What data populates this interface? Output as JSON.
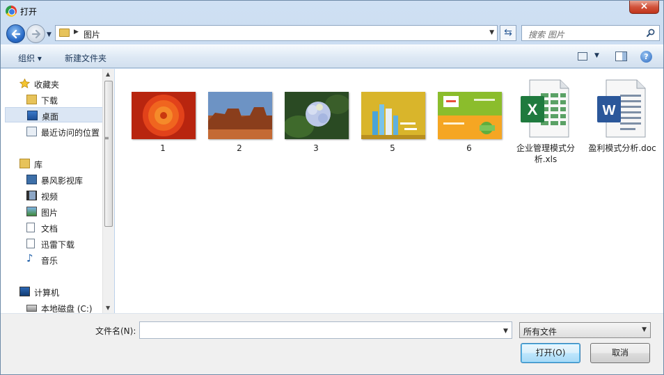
{
  "window": {
    "title": "打开",
    "close_label": "×"
  },
  "address": {
    "path": "图片",
    "search_placeholder": "搜索 图片"
  },
  "toolbar": {
    "organize_label": "组织 ▾",
    "new_folder_label": "新建文件夹"
  },
  "nav": {
    "favorites": {
      "label": "收藏夹",
      "items": [
        {
          "label": "下载"
        },
        {
          "label": "桌面"
        },
        {
          "label": "最近访问的位置"
        }
      ]
    },
    "libraries": {
      "label": "库",
      "items": [
        {
          "label": "暴风影视库"
        },
        {
          "label": "视频"
        },
        {
          "label": "图片"
        },
        {
          "label": "文档"
        },
        {
          "label": "迅雷下载"
        },
        {
          "label": "音乐"
        }
      ]
    },
    "computer": {
      "label": "计算机",
      "items": [
        {
          "label": "本地磁盘 (C:)"
        }
      ]
    }
  },
  "files": [
    {
      "name": "1",
      "kind": "image"
    },
    {
      "name": "2",
      "kind": "image"
    },
    {
      "name": "3",
      "kind": "image"
    },
    {
      "name": "5",
      "kind": "image"
    },
    {
      "name": "6",
      "kind": "image"
    },
    {
      "name": "企业管理模式分析.xls",
      "kind": "excel-icon"
    },
    {
      "name": "盈利模式分析.doc",
      "kind": "word-icon"
    }
  ],
  "bottom": {
    "filename_label": "文件名(N):",
    "filename_value": "",
    "filetype_value": "所有文件",
    "open_label": "打开(O)",
    "cancel_label": "取消"
  }
}
